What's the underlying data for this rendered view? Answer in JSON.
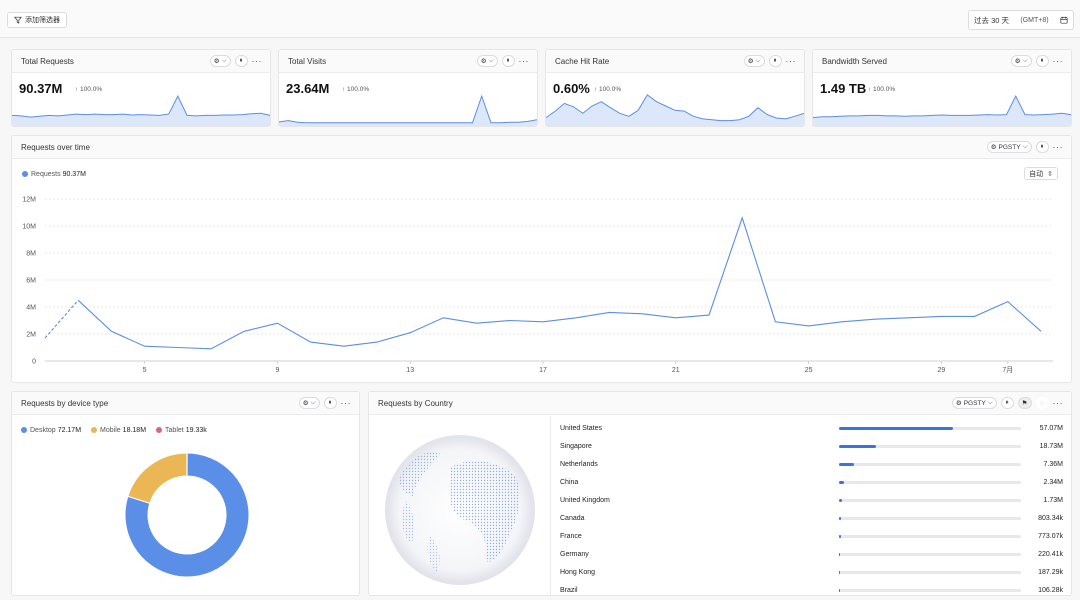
{
  "topbar": {
    "filter_label": "添加筛选器",
    "date_range": "过去 30 天",
    "timezone": "(GMT+8)"
  },
  "kpis": [
    {
      "title": "Total Requests",
      "value": "90.37M",
      "delta": "↑ 100.0%"
    },
    {
      "title": "Total Visits",
      "value": "23.64M",
      "delta": "↑ 100.0%"
    },
    {
      "title": "Cache Hit Rate",
      "value": "0.60%",
      "delta": "↑ 100.0%"
    },
    {
      "title": "Bandwidth Served",
      "value": "1.49 TB",
      "delta": "↑ 100.0%"
    }
  ],
  "sparklines": [
    [
      2.0,
      1.9,
      1.6,
      1.8,
      2.0,
      1.9,
      2.1,
      2.3,
      2.2,
      2.3,
      2.2,
      2.2,
      2.3,
      2.1,
      2.2,
      2.1,
      2.0,
      2.3,
      6.5,
      2.0,
      1.9,
      2.0,
      2.0,
      2.1,
      2.1,
      2.2,
      2.4,
      2.5,
      2.0
    ],
    [
      0.5,
      0.8,
      0.4,
      0.3,
      0.3,
      0.3,
      0.3,
      0.3,
      0.3,
      0.3,
      0.3,
      0.3,
      0.3,
      0.3,
      0.3,
      0.3,
      0.3,
      0.3,
      0.3,
      0.3,
      0.3,
      0.3,
      6.5,
      0.3,
      0.3,
      0.4,
      0.4,
      0.6,
      1.0
    ],
    [
      1.5,
      3.0,
      4.8,
      4.0,
      2.5,
      4.2,
      5.2,
      3.8,
      2.5,
      1.8,
      3.2,
      6.8,
      5.2,
      4.2,
      3.2,
      3.0,
      1.8,
      1.2,
      1.0,
      0.8,
      0.8,
      1.0,
      1.8,
      3.8,
      2.2,
      1.4,
      1.2,
      1.8,
      2.5
    ],
    [
      1.5,
      1.7,
      1.7,
      1.8,
      1.9,
      1.9,
      2.0,
      2.0,
      1.9,
      1.9,
      1.8,
      1.9,
      1.9,
      2.0,
      2.1,
      2.0,
      2.0,
      2.0,
      2.1,
      2.2,
      2.1,
      2.2,
      6.5,
      2.2,
      2.1,
      2.2,
      2.3,
      2.5,
      2.2
    ]
  ],
  "timeseries": {
    "title": "Requests over time",
    "region_label": "PGSTY",
    "legend_label": "Requests",
    "legend_value": "90.37M",
    "auto_label": "自动"
  },
  "device": {
    "title": "Requests by device type",
    "legend": [
      {
        "label": "Desktop",
        "value": "72.17M"
      },
      {
        "label": "Mobile",
        "value": "18.18M"
      },
      {
        "label": "Tablet",
        "value": "19.33k"
      }
    ]
  },
  "country": {
    "title": "Requests by Country",
    "region_label": "PGSTY",
    "rows": [
      {
        "name": "United States",
        "value": "57.07M",
        "share": 0.6258
      },
      {
        "name": "Singapore",
        "value": "18.73M",
        "share": 0.2054
      },
      {
        "name": "Netherlands",
        "value": "7.36M",
        "share": 0.0807
      },
      {
        "name": "China",
        "value": "2.34M",
        "share": 0.0257
      },
      {
        "name": "United Kingdom",
        "value": "1.73M",
        "share": 0.019
      },
      {
        "name": "Canada",
        "value": "803.34k",
        "share": 0.0088
      },
      {
        "name": "France",
        "value": "773.07k",
        "share": 0.0085
      },
      {
        "name": "Germany",
        "value": "220.41k",
        "share": 0.0024
      },
      {
        "name": "Hong Kong",
        "value": "187.29k",
        "share": 0.0021
      },
      {
        "name": "Brazil",
        "value": "106.28k",
        "share": 0.0012
      }
    ]
  },
  "chart_data": [
    {
      "type": "line",
      "x": [
        "2",
        "3",
        "4",
        "5",
        "6",
        "7",
        "8",
        "9",
        "10",
        "11",
        "12",
        "13",
        "14",
        "15",
        "16",
        "17",
        "18",
        "19",
        "20",
        "21",
        "22",
        "23",
        "24",
        "25",
        "26",
        "27",
        "28",
        "29",
        "30",
        "7月",
        "2"
      ],
      "x_tick_labels": [
        "5",
        "9",
        "13",
        "17",
        "21",
        "25",
        "29",
        "7月"
      ],
      "series": [
        {
          "name": "Requests",
          "values": [
            1.7,
            4.5,
            2.2,
            1.1,
            1.0,
            0.9,
            2.2,
            2.8,
            1.4,
            1.1,
            1.4,
            2.1,
            3.2,
            2.8,
            3.0,
            2.9,
            3.2,
            3.6,
            3.5,
            3.2,
            3.4,
            10.6,
            2.9,
            2.6,
            2.9,
            3.1,
            3.2,
            3.3,
            3.3,
            4.4,
            2.2
          ]
        }
      ],
      "y_tick_labels": [
        "0",
        "2M",
        "4M",
        "6M",
        "8M",
        "10M",
        "12M"
      ],
      "ylim": [
        0,
        12
      ],
      "grid": true,
      "legend": "top-left"
    },
    {
      "type": "pie",
      "categories": [
        "Desktop",
        "Mobile",
        "Tablet"
      ],
      "values": [
        72.17,
        18.18,
        0.01933
      ],
      "colors": [
        "#5b8ee6",
        "#eab754",
        "#d9657a"
      ]
    },
    {
      "type": "bar",
      "categories": [
        "United States",
        "Singapore",
        "Netherlands",
        "China",
        "United Kingdom",
        "Canada",
        "France",
        "Germany",
        "Hong Kong",
        "Brazil"
      ],
      "values": [
        57.07,
        18.73,
        7.36,
        2.34,
        1.73,
        0.80334,
        0.77307,
        0.22041,
        0.18729,
        0.10628
      ]
    }
  ],
  "colors": {
    "line": "#5b8ee6",
    "bar": "#3a72e6",
    "desktop": "#5b8ee6",
    "mobile": "#eab754",
    "tablet": "#d9657a"
  }
}
